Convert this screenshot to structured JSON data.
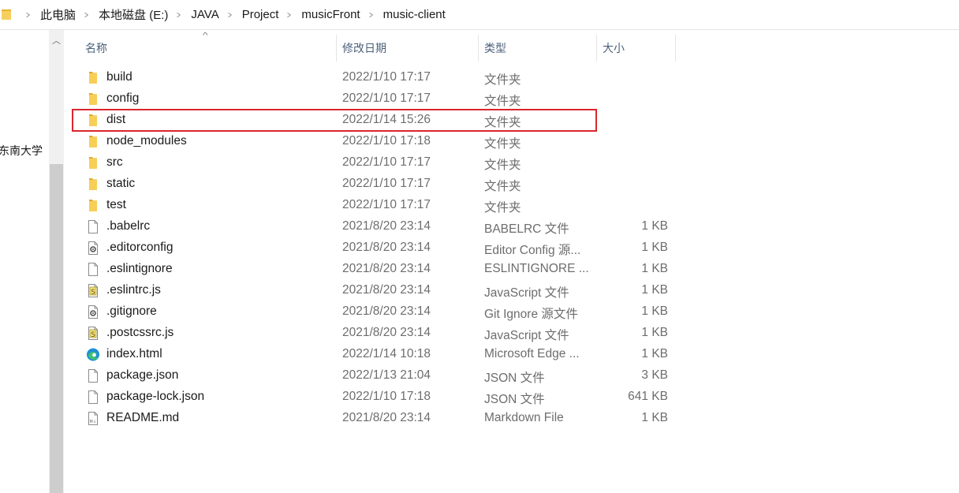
{
  "breadcrumb": [
    "此电脑",
    "本地磁盘 (E:)",
    "JAVA",
    "Project",
    "musicFront",
    "music-client"
  ],
  "nav": {
    "item": "东南大学"
  },
  "columns": {
    "name": "名称",
    "date": "修改日期",
    "type": "类型",
    "size": "大小"
  },
  "files": [
    {
      "name": "build",
      "date": "2022/1/10 17:17",
      "type": "文件夹",
      "size": "",
      "icon": "folder-icon"
    },
    {
      "name": "config",
      "date": "2022/1/10 17:17",
      "type": "文件夹",
      "size": "",
      "icon": "folder-icon"
    },
    {
      "name": "dist",
      "date": "2022/1/14 15:26",
      "type": "文件夹",
      "size": "",
      "icon": "folder-icon",
      "selected": true
    },
    {
      "name": "node_modules",
      "date": "2022/1/10 17:18",
      "type": "文件夹",
      "size": "",
      "icon": "folder-icon"
    },
    {
      "name": "src",
      "date": "2022/1/10 17:17",
      "type": "文件夹",
      "size": "",
      "icon": "folder-icon"
    },
    {
      "name": "static",
      "date": "2022/1/10 17:17",
      "type": "文件夹",
      "size": "",
      "icon": "folder-icon"
    },
    {
      "name": "test",
      "date": "2022/1/10 17:17",
      "type": "文件夹",
      "size": "",
      "icon": "folder-icon"
    },
    {
      "name": ".babelrc",
      "date": "2021/8/20 23:14",
      "type": "BABELRC 文件",
      "size": "1 KB",
      "icon": "file-icon"
    },
    {
      "name": ".editorconfig",
      "date": "2021/8/20 23:14",
      "type": "Editor Config 源...",
      "size": "1 KB",
      "icon": "gear-file-icon"
    },
    {
      "name": ".eslintignore",
      "date": "2021/8/20 23:14",
      "type": "ESLINTIGNORE ...",
      "size": "1 KB",
      "icon": "file-icon"
    },
    {
      "name": ".eslintrc.js",
      "date": "2021/8/20 23:14",
      "type": "JavaScript 文件",
      "size": "1 KB",
      "icon": "script-file-icon"
    },
    {
      "name": ".gitignore",
      "date": "2021/8/20 23:14",
      "type": "Git Ignore 源文件",
      "size": "1 KB",
      "icon": "gear-file-icon"
    },
    {
      "name": ".postcssrc.js",
      "date": "2021/8/20 23:14",
      "type": "JavaScript 文件",
      "size": "1 KB",
      "icon": "script-file-icon"
    },
    {
      "name": "index.html",
      "date": "2022/1/14 10:18",
      "type": "Microsoft Edge ...",
      "size": "1 KB",
      "icon": "edge-icon"
    },
    {
      "name": "package.json",
      "date": "2022/1/13 21:04",
      "type": "JSON 文件",
      "size": "3 KB",
      "icon": "file-icon"
    },
    {
      "name": "package-lock.json",
      "date": "2022/1/10 17:18",
      "type": "JSON 文件",
      "size": "641 KB",
      "icon": "file-icon"
    },
    {
      "name": "README.md",
      "date": "2021/8/20 23:14",
      "type": "Markdown File",
      "size": "1 KB",
      "icon": "markdown-file-icon"
    }
  ]
}
